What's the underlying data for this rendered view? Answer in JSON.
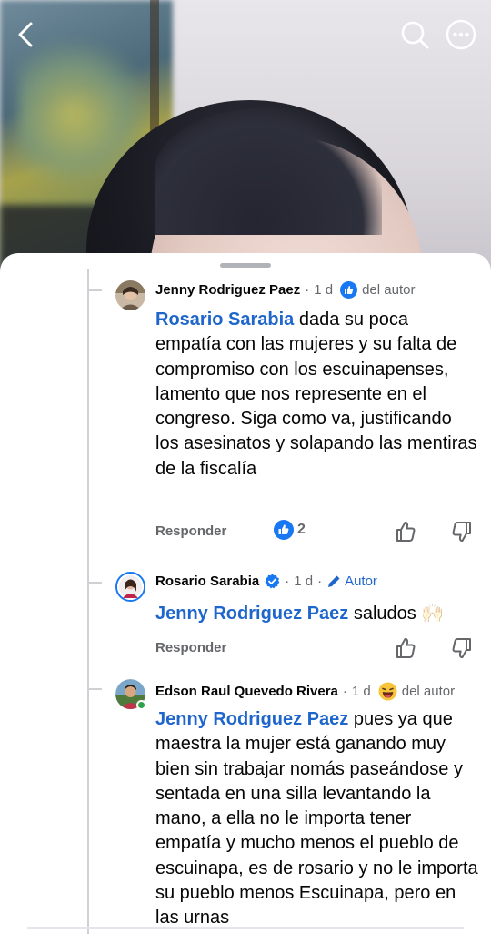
{
  "header": {
    "back_icon": "chevron-left-icon",
    "search_icon": "search-icon",
    "more_icon": "more-horizontal-icon"
  },
  "comments": [
    {
      "author": "Jenny Rodriguez Paez",
      "time": "1 d",
      "badge": "del autor",
      "badge_icon": "thumbs-up-badge-icon",
      "mention": "Rosario Sarabia",
      "text": " dada su poca empatía con las mujeres y su falta de compromiso con los escuinapenses, lamento que nos represente en el congreso. Siga como va, justificando los asesinatos y solapando las mentiras de la fiscalía",
      "reply_label": "Responder",
      "reaction_count": "2"
    },
    {
      "author": "Rosario Sarabia",
      "time": "1 d",
      "badge": "Autor",
      "badge_icon": "pencil-icon",
      "verified": true,
      "mention": "Jenny Rodriguez Paez",
      "text": " saludos ",
      "emoji": "🙌🏻",
      "reply_label": "Responder"
    },
    {
      "author": "Edson Raul Quevedo Rivera",
      "time": "1 d",
      "badge": "del autor",
      "badge_icon": "laughing-emoji-icon",
      "mention": "Jenny Rodriguez Paez",
      "text": " pues ya que maestra la mujer está ganando muy bien sin trabajar nomás paseándose y sentada en una silla levantando la mano, a ella no le importa tener empatía y mucho menos el pueblo de escuinapa, es de rosario y no le importa su pueblo menos Escuinapa, pero en las urnas"
    }
  ],
  "colors": {
    "accent": "#1e66cc",
    "facebook_blue": "#1877f2",
    "secondary_text": "#65676b"
  }
}
